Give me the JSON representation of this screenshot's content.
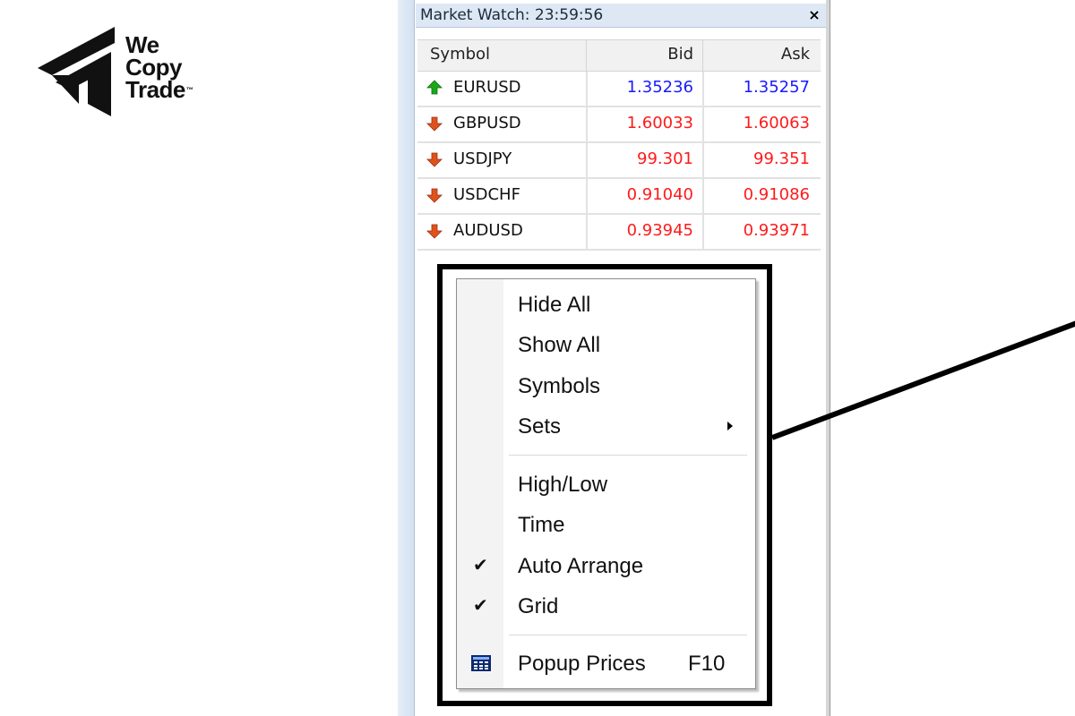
{
  "logo": {
    "line1": "We",
    "line2": "Copy",
    "line3": "Trade",
    "tm": "™"
  },
  "market_watch": {
    "title": "Market Watch: 23:59:56",
    "close_label": "×",
    "columns": {
      "symbol": "Symbol",
      "bid": "Bid",
      "ask": "Ask"
    },
    "rows": [
      {
        "symbol": "EURUSD",
        "bid": "1.35236",
        "ask": "1.35257",
        "direction": "up",
        "price_color": "#1a1aff"
      },
      {
        "symbol": "GBPUSD",
        "bid": "1.60033",
        "ask": "1.60063",
        "direction": "down",
        "price_color": "#ff1a1a"
      },
      {
        "symbol": "USDJPY",
        "bid": "99.301",
        "ask": "99.351",
        "direction": "down",
        "price_color": "#ff1a1a"
      },
      {
        "symbol": "USDCHF",
        "bid": "0.91040",
        "ask": "0.91086",
        "direction": "down",
        "price_color": "#ff1a1a"
      },
      {
        "symbol": "AUDUSD",
        "bid": "0.93945",
        "ask": "0.93971",
        "direction": "down",
        "price_color": "#ff1a1a"
      }
    ]
  },
  "context_menu": {
    "items": [
      {
        "label": "Hide All"
      },
      {
        "label": "Show All"
      },
      {
        "label": "Symbols"
      },
      {
        "label": "Sets",
        "submenu": true
      },
      {
        "label": "High/Low"
      },
      {
        "label": "Time"
      },
      {
        "label": "Auto Arrange",
        "checked": true
      },
      {
        "label": "Grid",
        "checked": true
      },
      {
        "label": "Popup Prices",
        "shortcut": "F10",
        "icon": "popup-prices-icon"
      }
    ],
    "check_glyph": "✔"
  },
  "colors": {
    "up_arrow": "#1aa81a",
    "down_arrow": "#e0521c",
    "title_bar": "#dde8f4"
  }
}
